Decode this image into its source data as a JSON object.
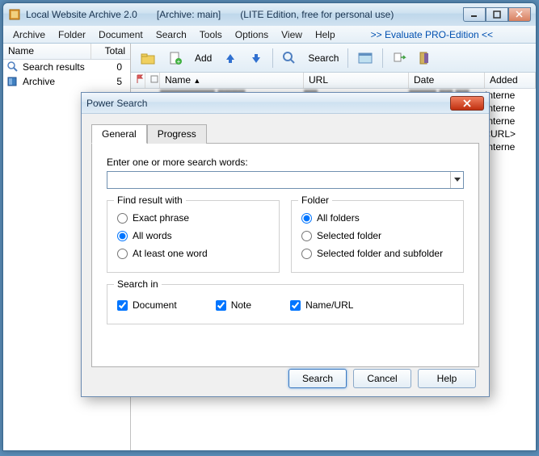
{
  "window": {
    "title": "Local Website Archive  2.0",
    "archive_tag": "[Archive: main]",
    "edition": "(LITE Edition, free for personal use)"
  },
  "menubar": {
    "items": [
      "Archive",
      "Folder",
      "Document",
      "Search",
      "Tools",
      "Options",
      "View",
      "Help"
    ],
    "evaluate": ">> Evaluate PRO-Edition <<"
  },
  "sidebar": {
    "col_name": "Name",
    "col_total": "Total",
    "rows": [
      {
        "label": "Search results",
        "count": "0"
      },
      {
        "label": "Archive",
        "count": "5"
      }
    ]
  },
  "toolbar": {
    "add": "Add",
    "search": "Search"
  },
  "list": {
    "cols": {
      "name": "Name",
      "url": "URL",
      "date": "Date",
      "added": "Added"
    },
    "rows": [
      {
        "added": "Interne"
      },
      {
        "added": "Interne"
      },
      {
        "added": "Interne"
      },
      {
        "added": "<URL>"
      },
      {
        "added": "Interne"
      }
    ]
  },
  "dialog": {
    "title": "Power Search",
    "tabs": {
      "general": "General",
      "progress": "Progress"
    },
    "search_label": "Enter one or more search words:",
    "find_group": {
      "title": "Find result with",
      "exact": "Exact phrase",
      "all": "All words",
      "atleast": "At least one word"
    },
    "folder_group": {
      "title": "Folder",
      "all": "All folders",
      "selected": "Selected folder",
      "sub": "Selected folder and subfolder"
    },
    "searchin_group": {
      "title": "Search in",
      "doc": "Document",
      "note": "Note",
      "nameurl": "Name/URL"
    },
    "buttons": {
      "search": "Search",
      "cancel": "Cancel",
      "help": "Help"
    }
  }
}
